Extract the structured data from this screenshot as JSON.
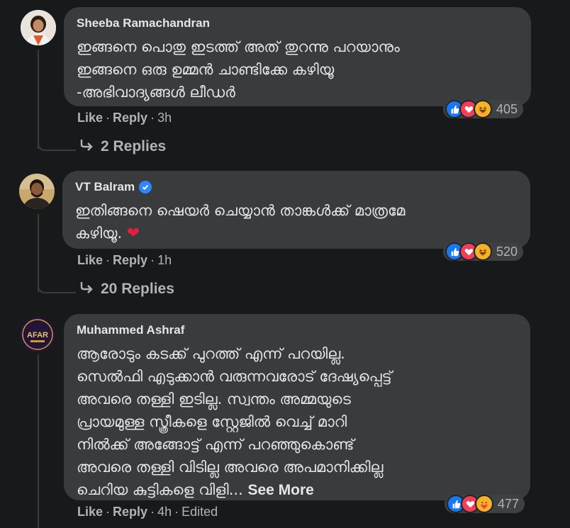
{
  "comments": [
    {
      "author": "Sheeba Ramachandran",
      "verified": false,
      "text": "ഇങ്ങനെ പൊതു ഇടത്ത് അത് തുറന്നു പറയാനും\nഇങ്ങനെ ഒരു ഉമ്മൻ ചാണ്ടിക്കേ കഴിയൂ\n-അഭിവാദ്യങ്ങൾ ലീഡർ",
      "actions": {
        "like": "Like",
        "reply": "Reply",
        "time": "3h"
      },
      "reactions": {
        "count": "405",
        "types": [
          "like-icon",
          "love-icon",
          "haha-icon"
        ]
      },
      "replies_label": "2 Replies"
    },
    {
      "author": "VT Balram",
      "verified": true,
      "text": "ഇതിങ്ങനെ ഷെയർ ചെയ്യാൻ താങ്കൾക്ക് മാത്രമേ\nകഴിയൂ. ",
      "emoji": "❤",
      "actions": {
        "like": "Like",
        "reply": "Reply",
        "time": "1h"
      },
      "reactions": {
        "count": "520",
        "types": [
          "like-icon",
          "love-icon",
          "haha-icon"
        ]
      },
      "replies_label": "20 Replies"
    },
    {
      "author": "Muhammed Ashraf",
      "verified": false,
      "avatar_text": "AFAR",
      "text": "ആരോടും കടക്ക് പുറത്ത് എന്ന് പറയില്ല.\nസെൽഫി എടുക്കാൻ വരുന്നവരോട് ദേഷ്യപ്പെട്ട്\nഅവരെ തള്ളി ഇടില്ല. സ്വന്തം അമ്മയുടെ\nപ്രായമുള്ള സ്ത്രീകളെ സ്റ്റേജിൽ വെച്ച് മാറി\nനിൽക്ക് അങ്ങോട്ട് എന്ന് പറഞ്ഞുകൊണ്ട്\nഅവരെ തള്ളി വിടില്ല അവരെ അപമാനിക്കില്ല\nചെറിയ കുട്ടികളെ വിളി... ",
      "see_more": "See More",
      "actions": {
        "like": "Like",
        "reply": "Reply",
        "time": "4h",
        "edited": "Edited"
      },
      "reactions": {
        "count": "477",
        "types": [
          "like-icon",
          "love-icon",
          "care-icon"
        ]
      }
    }
  ],
  "colors": {
    "background": "#18191a",
    "bubble": "#3a3b3c",
    "text": "#e4e6eb",
    "secondary_text": "#b0b3b8",
    "like_blue": "#1877f2",
    "love_red": "#f33e58",
    "haha_yellow": "#f7b125"
  }
}
